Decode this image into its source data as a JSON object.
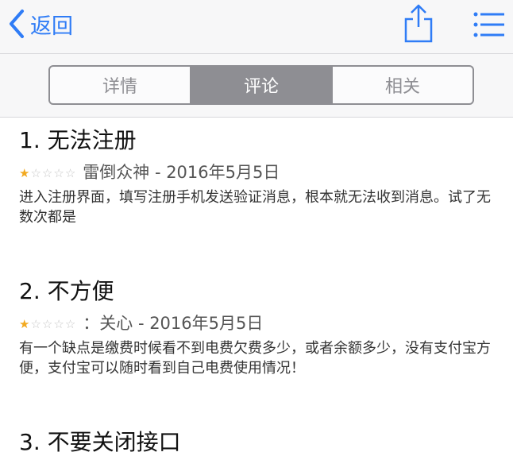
{
  "nav": {
    "back_label": "返回",
    "accent_color": "#2f7cf6",
    "share_icon": "share-icon",
    "menu_icon": "list-menu-icon"
  },
  "tabs": [
    {
      "label": "详情",
      "active": false
    },
    {
      "label": "评论",
      "active": true
    },
    {
      "label": "相关",
      "active": false
    }
  ],
  "reviews": [
    {
      "title": "1. 无法注册",
      "rating": 1,
      "max_rating": 5,
      "meta": "雷倒众神 - 2016年5月5日",
      "body": "进入注册界面，填写注册手机发送验证消息，根本就无法收到消息。试了无数次都是"
    },
    {
      "title": "2. 不方便",
      "rating": 1,
      "max_rating": 5,
      "meta": "：关心 - 2016年5月5日",
      "body": "有一个缺点是缴费时候看不到电费欠费多少，或者余额多少，没有支付宝方便，支付宝可以随时看到自己电费使用情况！"
    },
    {
      "title": "3. 不要关闭接口"
    }
  ],
  "star_color": "#f2a91f"
}
